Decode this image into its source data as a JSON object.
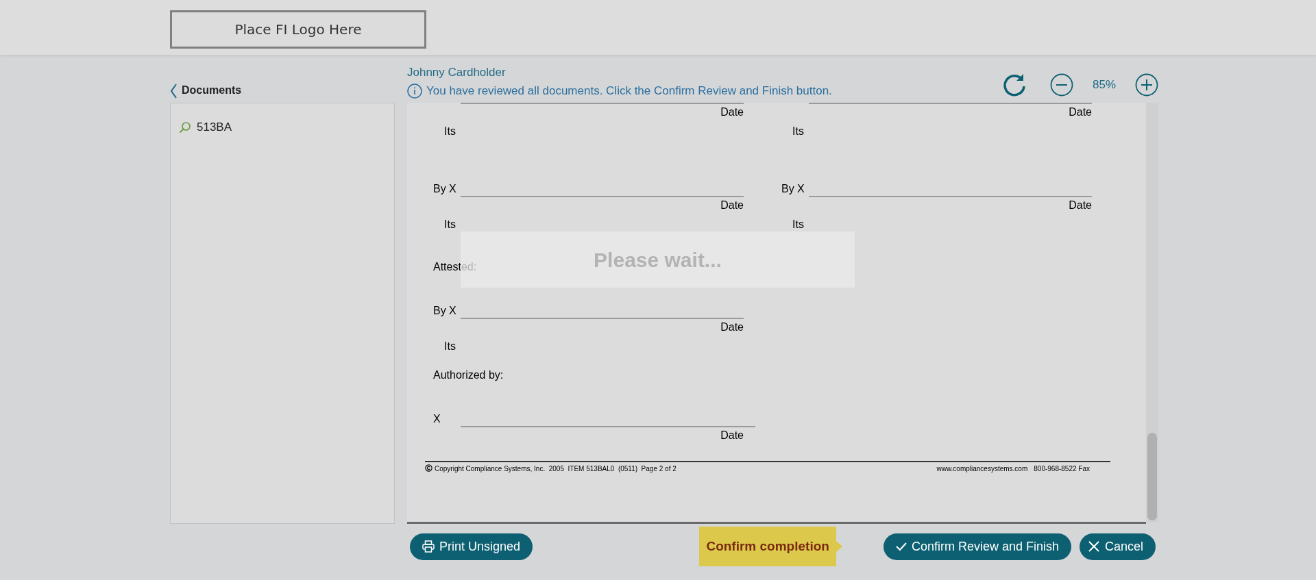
{
  "header": {
    "logo_text": "Place FI Logo Here"
  },
  "sidebar": {
    "back_label": "Documents",
    "items": [
      {
        "label": "513BA"
      }
    ]
  },
  "viewer": {
    "cardholder": "Johnny Cardholder",
    "info": "You have reviewed all documents. Click the Confirm Review and Finish button.",
    "zoom": "85%"
  },
  "document": {
    "rows": [
      {
        "kind": "signature",
        "columns": [
          {
            "date": "Date",
            "its": "Its"
          },
          {
            "date": "Date",
            "its": "Its"
          }
        ]
      },
      {
        "kind": "signature",
        "columns": [
          {
            "by": "By X",
            "date": "Date",
            "its": "Its"
          },
          {
            "by": "By X",
            "date": "Date",
            "its": "Its"
          }
        ]
      },
      {
        "kind": "label",
        "text": "Attested:"
      },
      {
        "kind": "signature",
        "columns": [
          {
            "by": "By X",
            "date": "Date",
            "its": "Its"
          }
        ]
      },
      {
        "kind": "label",
        "text": "Authorized by:"
      },
      {
        "kind": "signature",
        "columns": [
          {
            "by": "X",
            "date": "Date"
          }
        ]
      }
    ],
    "footer": {
      "left": "Copyright Compliance Systems, Inc.  2005  ITEM 513BAL0  (0511)  Page 2 of 2",
      "site": "www.compliancesystems.com",
      "fax": "800-968-8522 Fax"
    },
    "overlay": {
      "text": "Please wait..."
    }
  },
  "footer_bar": {
    "print": "Print Unsigned",
    "tooltip": "Confirm completion",
    "confirm": "Confirm Review and Finish",
    "cancel": "Cancel"
  }
}
